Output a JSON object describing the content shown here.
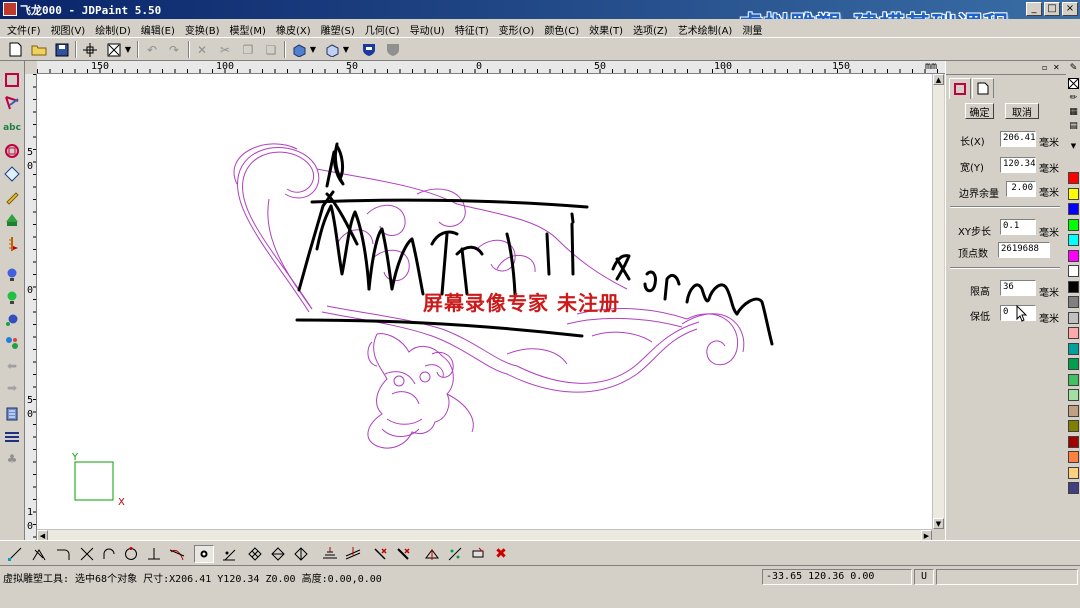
{
  "window": {
    "title": "飞龙000 - JDPaint 5.50",
    "controls": [
      "_",
      "□",
      "×"
    ]
  },
  "banner": "虚拟雕塑-建模基础课程",
  "menu": [
    "文件(F)",
    "视图(V)",
    "绘制(D)",
    "编辑(E)",
    "变换(B)",
    "模型(M)",
    "橡皮(X)",
    "雕塑(S)",
    "几何(C)",
    "导动(U)",
    "特征(T)",
    "变形(O)",
    "颜色(C)",
    "效果(T)",
    "选项(Z)",
    "艺术绘制(A)",
    "测量"
  ],
  "ruler": {
    "top_labels": [
      "150",
      "100",
      "50",
      "0",
      "50",
      "100",
      "150"
    ],
    "unit": "mm",
    "left_labels": [
      "5",
      "0",
      "0",
      "5",
      "0",
      "1",
      "0"
    ]
  },
  "canvas": {
    "watermark": "屏幕录像专家  未注册",
    "axis_y": "Y",
    "axis_x": "X"
  },
  "panel": {
    "confirm": "确定",
    "cancel": "取消",
    "length_label": "长(X)",
    "length_value": "206.41",
    "width_label": "宽(Y)",
    "width_value": "120.34",
    "margin_label": "边界余量",
    "margin_value": "2.00",
    "xy_step_label": "XY步长",
    "xy_step_value": "0.1",
    "vertex_count_label": "顶点数",
    "vertex_count_value": "2619688",
    "limit_high_label": "限高",
    "limit_high_value": "36",
    "keep_low_label": "保低",
    "keep_low_value": "0",
    "unit": "毫米"
  },
  "palette_colors": [
    "#ff0000",
    "#ffff00",
    "#0000ff",
    "#00ff00",
    "#00ffff",
    "#ff00ff",
    "#ffffff",
    "#000000",
    "#808080",
    "#c0c0c0",
    "#ffaaaa",
    "#00a0a0",
    "#00a050",
    "#40c060",
    "#a0e0a0",
    "#c0a080",
    "#808000",
    "#a00000",
    "#ff8040",
    "#ffd080",
    "#404080"
  ],
  "status": {
    "message": "虚拟雕塑工具: 选中68个对象 尺寸:X206.41 Y120.34 Z0.00 高度:0.00,0.00",
    "coords": "-33.65 120.36 0.00",
    "mode": "U"
  }
}
